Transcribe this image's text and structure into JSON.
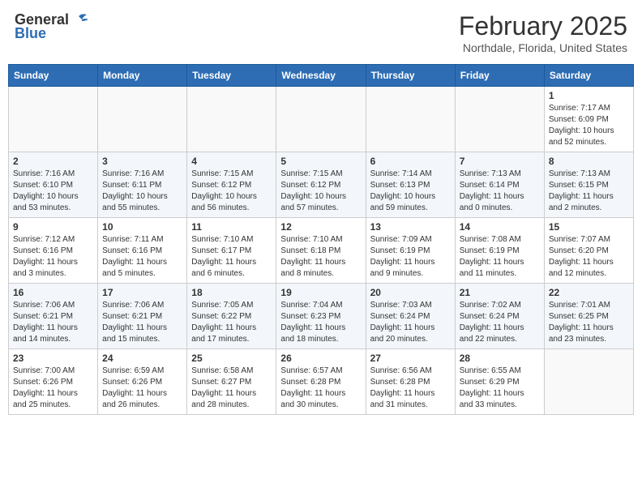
{
  "header": {
    "logo_general": "General",
    "logo_blue": "Blue",
    "title": "February 2025",
    "subtitle": "Northdale, Florida, United States"
  },
  "calendar": {
    "days_of_week": [
      "Sunday",
      "Monday",
      "Tuesday",
      "Wednesday",
      "Thursday",
      "Friday",
      "Saturday"
    ],
    "weeks": [
      {
        "alt": false,
        "days": [
          {
            "num": "",
            "info": ""
          },
          {
            "num": "",
            "info": ""
          },
          {
            "num": "",
            "info": ""
          },
          {
            "num": "",
            "info": ""
          },
          {
            "num": "",
            "info": ""
          },
          {
            "num": "",
            "info": ""
          },
          {
            "num": "1",
            "info": "Sunrise: 7:17 AM\nSunset: 6:09 PM\nDaylight: 10 hours\nand 52 minutes."
          }
        ]
      },
      {
        "alt": true,
        "days": [
          {
            "num": "2",
            "info": "Sunrise: 7:16 AM\nSunset: 6:10 PM\nDaylight: 10 hours\nand 53 minutes."
          },
          {
            "num": "3",
            "info": "Sunrise: 7:16 AM\nSunset: 6:11 PM\nDaylight: 10 hours\nand 55 minutes."
          },
          {
            "num": "4",
            "info": "Sunrise: 7:15 AM\nSunset: 6:12 PM\nDaylight: 10 hours\nand 56 minutes."
          },
          {
            "num": "5",
            "info": "Sunrise: 7:15 AM\nSunset: 6:12 PM\nDaylight: 10 hours\nand 57 minutes."
          },
          {
            "num": "6",
            "info": "Sunrise: 7:14 AM\nSunset: 6:13 PM\nDaylight: 10 hours\nand 59 minutes."
          },
          {
            "num": "7",
            "info": "Sunrise: 7:13 AM\nSunset: 6:14 PM\nDaylight: 11 hours\nand 0 minutes."
          },
          {
            "num": "8",
            "info": "Sunrise: 7:13 AM\nSunset: 6:15 PM\nDaylight: 11 hours\nand 2 minutes."
          }
        ]
      },
      {
        "alt": false,
        "days": [
          {
            "num": "9",
            "info": "Sunrise: 7:12 AM\nSunset: 6:16 PM\nDaylight: 11 hours\nand 3 minutes."
          },
          {
            "num": "10",
            "info": "Sunrise: 7:11 AM\nSunset: 6:16 PM\nDaylight: 11 hours\nand 5 minutes."
          },
          {
            "num": "11",
            "info": "Sunrise: 7:10 AM\nSunset: 6:17 PM\nDaylight: 11 hours\nand 6 minutes."
          },
          {
            "num": "12",
            "info": "Sunrise: 7:10 AM\nSunset: 6:18 PM\nDaylight: 11 hours\nand 8 minutes."
          },
          {
            "num": "13",
            "info": "Sunrise: 7:09 AM\nSunset: 6:19 PM\nDaylight: 11 hours\nand 9 minutes."
          },
          {
            "num": "14",
            "info": "Sunrise: 7:08 AM\nSunset: 6:19 PM\nDaylight: 11 hours\nand 11 minutes."
          },
          {
            "num": "15",
            "info": "Sunrise: 7:07 AM\nSunset: 6:20 PM\nDaylight: 11 hours\nand 12 minutes."
          }
        ]
      },
      {
        "alt": true,
        "days": [
          {
            "num": "16",
            "info": "Sunrise: 7:06 AM\nSunset: 6:21 PM\nDaylight: 11 hours\nand 14 minutes."
          },
          {
            "num": "17",
            "info": "Sunrise: 7:06 AM\nSunset: 6:21 PM\nDaylight: 11 hours\nand 15 minutes."
          },
          {
            "num": "18",
            "info": "Sunrise: 7:05 AM\nSunset: 6:22 PM\nDaylight: 11 hours\nand 17 minutes."
          },
          {
            "num": "19",
            "info": "Sunrise: 7:04 AM\nSunset: 6:23 PM\nDaylight: 11 hours\nand 18 minutes."
          },
          {
            "num": "20",
            "info": "Sunrise: 7:03 AM\nSunset: 6:24 PM\nDaylight: 11 hours\nand 20 minutes."
          },
          {
            "num": "21",
            "info": "Sunrise: 7:02 AM\nSunset: 6:24 PM\nDaylight: 11 hours\nand 22 minutes."
          },
          {
            "num": "22",
            "info": "Sunrise: 7:01 AM\nSunset: 6:25 PM\nDaylight: 11 hours\nand 23 minutes."
          }
        ]
      },
      {
        "alt": false,
        "days": [
          {
            "num": "23",
            "info": "Sunrise: 7:00 AM\nSunset: 6:26 PM\nDaylight: 11 hours\nand 25 minutes."
          },
          {
            "num": "24",
            "info": "Sunrise: 6:59 AM\nSunset: 6:26 PM\nDaylight: 11 hours\nand 26 minutes."
          },
          {
            "num": "25",
            "info": "Sunrise: 6:58 AM\nSunset: 6:27 PM\nDaylight: 11 hours\nand 28 minutes."
          },
          {
            "num": "26",
            "info": "Sunrise: 6:57 AM\nSunset: 6:28 PM\nDaylight: 11 hours\nand 30 minutes."
          },
          {
            "num": "27",
            "info": "Sunrise: 6:56 AM\nSunset: 6:28 PM\nDaylight: 11 hours\nand 31 minutes."
          },
          {
            "num": "28",
            "info": "Sunrise: 6:55 AM\nSunset: 6:29 PM\nDaylight: 11 hours\nand 33 minutes."
          },
          {
            "num": "",
            "info": ""
          }
        ]
      }
    ]
  }
}
